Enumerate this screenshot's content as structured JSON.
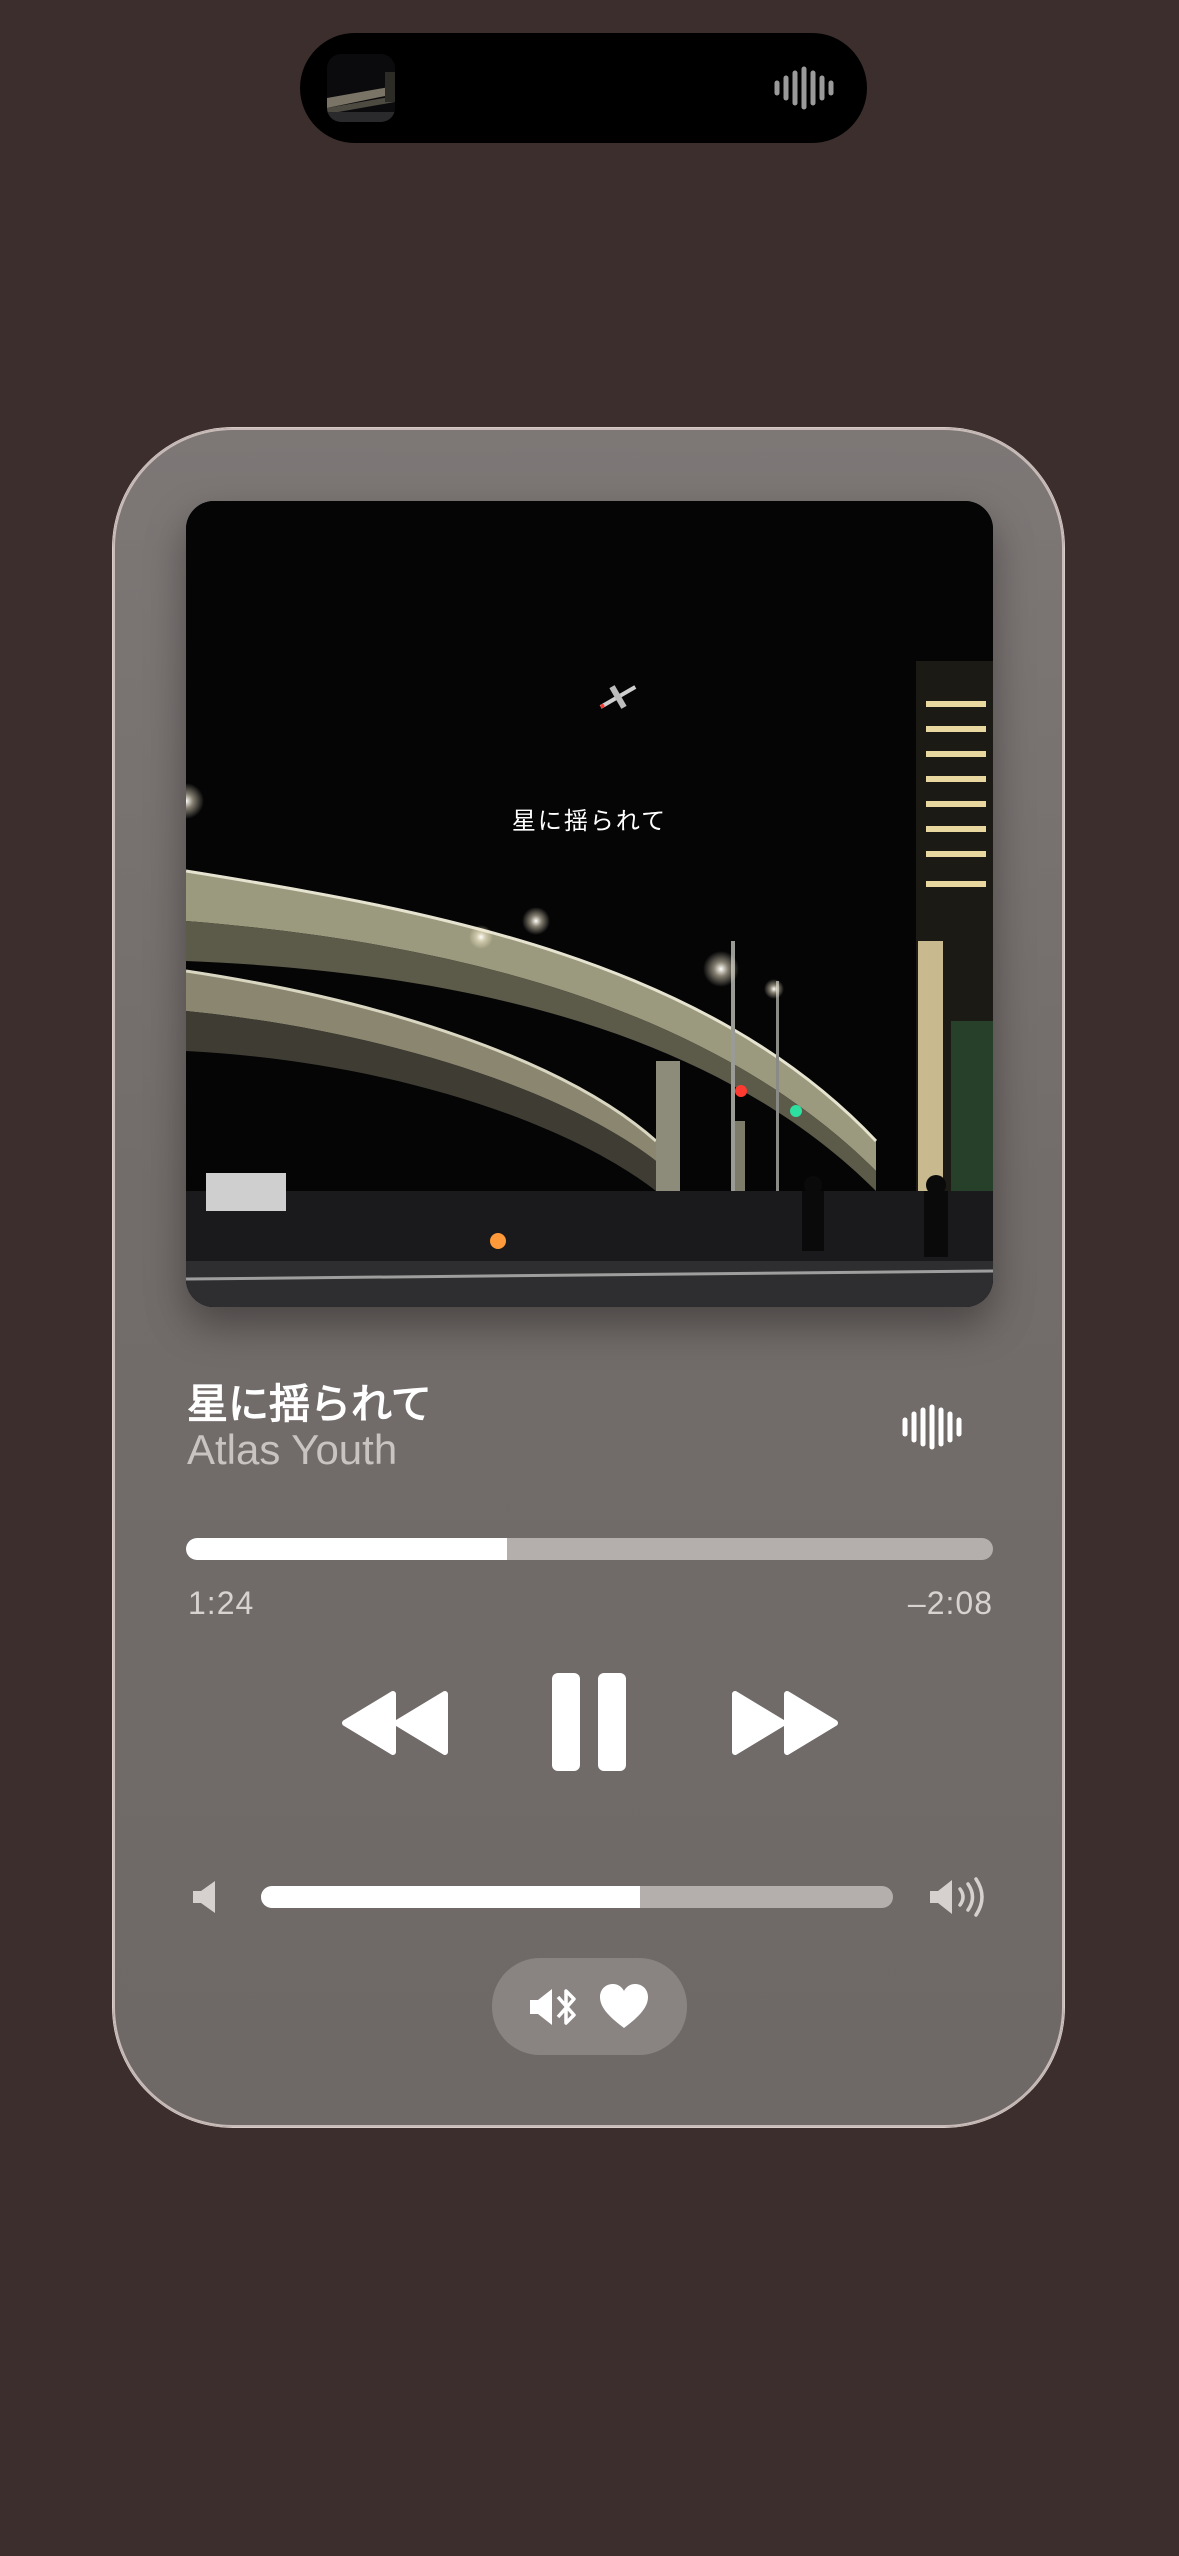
{
  "island": {
    "artwork_icon": "album-thumbnail",
    "indicator_icon": "waveform-icon"
  },
  "track": {
    "title": "星に揺られて",
    "artist": "Atlas Youth",
    "artwork_text": "星に揺られて"
  },
  "playback": {
    "elapsed": "1:24",
    "remaining": "–2:08",
    "progress": 0.398,
    "controls": [
      "rewind-icon",
      "pause-icon",
      "fast-forward-icon"
    ]
  },
  "volume": {
    "level": 0.6,
    "low_icon": "speaker-low-icon",
    "high_icon": "speaker-high-icon"
  },
  "route": {
    "audio_icon": "bluetooth-speaker-icon",
    "favorite_icon": "heart-icon"
  },
  "colors": {
    "background": "#3b2e2d",
    "card": "#75706e",
    "accent": "#ffffff",
    "track": "#b4aeac"
  }
}
